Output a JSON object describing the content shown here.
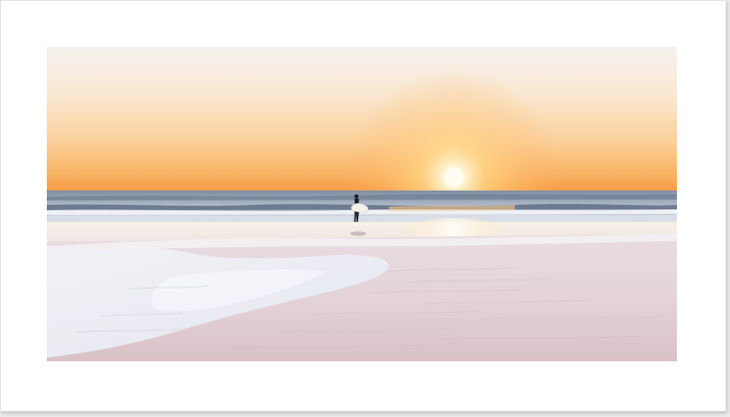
{
  "artwork": {
    "subject": "",
    "colors": {
      "sky_top": "#f6f0ec",
      "sky_mid": "#fbd9a8",
      "sky_horizon": "#f9a64a",
      "sun": "#fffbe8",
      "sea": "#8f9db2",
      "foam": "#eef2f6",
      "sand_light": "#f5eef0",
      "sand_pink": "#dcc4c8",
      "wet_sand": "#e9eef6"
    }
  }
}
